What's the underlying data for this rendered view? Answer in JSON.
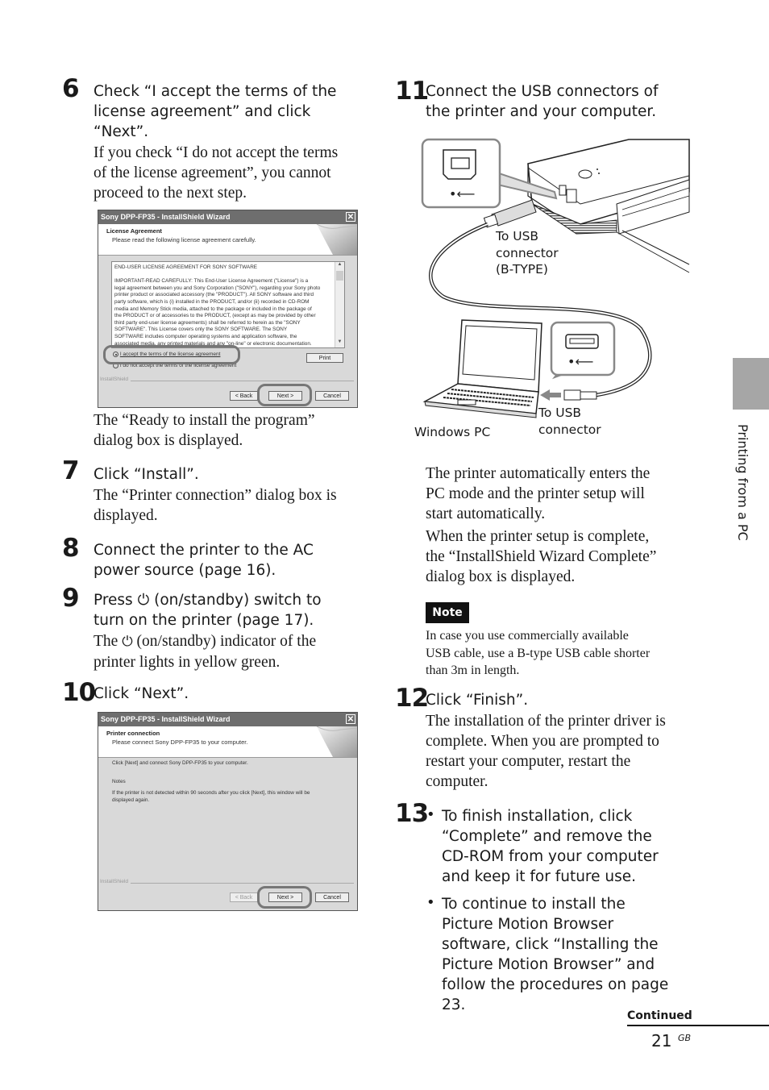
{
  "steps": {
    "s6": {
      "number": "6",
      "heading": [
        "Check “I accept the terms of the",
        "license agreement” and click",
        "“Next”."
      ],
      "body": [
        "If you check “I do not accept the terms",
        "of the license agreement”, you cannot",
        "proceed to the next step."
      ],
      "after": [
        "The “Ready to install the program”",
        "dialog box is displayed."
      ]
    },
    "s7": {
      "number": "7",
      "heading": [
        "Click “Install”."
      ],
      "body": [
        "The “Printer connection” dialog box is",
        "displayed."
      ]
    },
    "s8": {
      "number": "8",
      "heading": [
        "Connect the printer to the AC",
        "power source (page 16)."
      ]
    },
    "s9": {
      "number": "9",
      "heading_a": "Press",
      "heading_b": " (on/standby) switch to",
      "heading_2": "turn on the printer (page 17).",
      "body_a": "The",
      "body_b": " (on/standby) indicator of the",
      "body_2": "printer lights in yellow green.",
      "power_glyph": "⏻"
    },
    "s10": {
      "number": "10",
      "heading": [
        "Click “Next”."
      ]
    },
    "s11": {
      "number": "11",
      "heading": [
        "Connect the USB connectors of",
        "the printer and your computer."
      ],
      "body1": [
        "The printer automatically enters the",
        "PC mode and the printer setup will",
        "start automatically."
      ],
      "body2": [
        "When the printer setup is complete,",
        "the “InstallShield Wizard Complete”",
        "dialog box is displayed."
      ]
    },
    "s12": {
      "number": "12",
      "heading": [
        "Click “Finish”."
      ],
      "body": [
        "The installation of the printer driver is",
        "complete. When you are prompted to",
        "restart your computer, restart the",
        "computer."
      ]
    },
    "s13": {
      "number": "13",
      "bullet1": [
        "To finish installation, click",
        "“Complete” and remove the",
        "CD-ROM from your computer",
        "and keep it for future use."
      ],
      "bullet2": [
        "To continue to install the",
        "Picture Motion Browser",
        "software, click “Installing the",
        "Picture Motion Browser” and",
        "follow the procedures on page",
        "23."
      ]
    }
  },
  "dialog1": {
    "title": "Sony DPP-FP35 - InstallShield Wizard",
    "header_title": "License Agreement",
    "header_sub": "Please read the following license agreement carefully.",
    "license_lines": [
      "END-USER LICENSE AGREEMENT FOR SONY SOFTWARE",
      "",
      "IMPORTANT-READ CAREFULLY: This End-User License Agreement (\"License\") is a",
      "legal agreement between you and Sony Corporation (\"SONY\"), regarding your Sony photo",
      "printer product or associated accessory (the \"PRODUCT\"). All SONY software and third",
      "party software, which is (i) installed in the PRODUCT, and/or (ii) recorded in CD-ROM",
      "media and Memory Stick media, attached to the package or included in the package of",
      "the PRODUCT or of accessories to the PRODUCT, (except as may be provided by other",
      "third party end-user license agreements) shall be referred to herein as the \"SONY",
      "SOFTWARE\". This License covers only the SONY SOFTWARE. The SONY",
      "SOFTWARE includes computer operating systems and application software, the",
      "associated media, any printed materials and any \"on-line\" or electronic documentation."
    ],
    "radio_accept": "I accept the terms of the license agreement",
    "radio_decline": "I do not accept the terms of the license agreement",
    "print_label": "Print",
    "footer_brand": "InstallShield",
    "back_label": "< Back",
    "next_label": "Next >",
    "cancel_label": "Cancel"
  },
  "dialog2": {
    "title": "Sony DPP-FP35 - InstallShield Wizard",
    "header_title": "Printer connection",
    "header_sub": "Please connect Sony DPP-FP35 to your computer.",
    "instruction": "Click [Next] and connect Sony DPP-FP35 to your computer.",
    "notes_label": "Notes",
    "notes_lines": [
      "If the printer is not detected within 90 seconds after you click [Next], this window will be",
      "displayed again."
    ],
    "footer_brand": "InstallShield",
    "back_label": "< Back",
    "next_label": "Next >",
    "cancel_label": "Cancel"
  },
  "illustration": {
    "label_printer": [
      "To USB",
      "connector",
      "(B-TYPE)"
    ],
    "label_pc_connector": [
      "To USB",
      "connector"
    ],
    "label_pc": "Windows PC",
    "usb_glyph": "⭠"
  },
  "note": {
    "badge": "Note",
    "lines": [
      "In case you use commercially available",
      "USB cable, use a B-type USB cable shorter",
      "than 3m in length."
    ]
  },
  "side_tab": {
    "label": "Printing from a PC"
  },
  "footer": {
    "continued": "Continued",
    "page_number": "21",
    "region": "GB"
  }
}
